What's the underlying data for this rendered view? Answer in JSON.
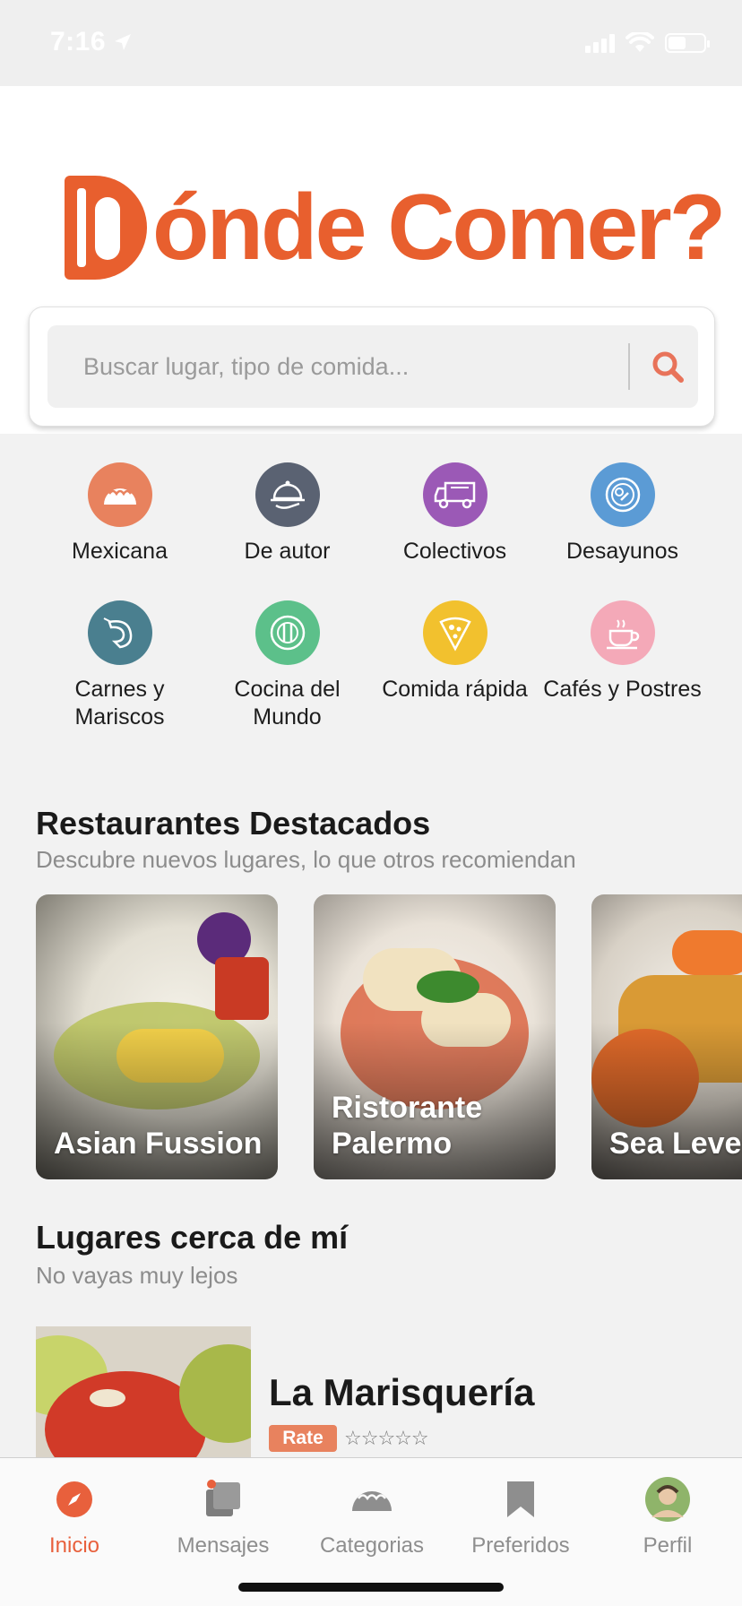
{
  "status_bar": {
    "time": "7:16"
  },
  "banner": {
    "logo_text": "ónde Comer?",
    "logo_full": "Dónde Comer?",
    "prev_label": "‹",
    "next_label": "›",
    "slides": 3,
    "active_slide": 0
  },
  "search": {
    "placeholder": "Buscar lugar, tipo de comida..."
  },
  "categories": [
    {
      "label": "Mexicana",
      "color": "#e8825e",
      "icon": "taco-icon"
    },
    {
      "label": "De autor",
      "color": "#5a6272",
      "icon": "cloche-icon"
    },
    {
      "label": "Colectivos",
      "color": "#9b59b6",
      "icon": "food-truck-icon"
    },
    {
      "label": "Desayunos",
      "color": "#5b9bd5",
      "icon": "breakfast-plate-icon"
    },
    {
      "label": "Carnes y Mariscos",
      "color": "#4a7f8f",
      "icon": "shrimp-icon"
    },
    {
      "label": "Cocina del Mundo",
      "color": "#5cc08a",
      "icon": "cutlery-plate-icon"
    },
    {
      "label": "Comida rápida",
      "color": "#f2c12e",
      "icon": "pizza-slice-icon"
    },
    {
      "label": "Cafés y Postres",
      "color": "#f4a9b8",
      "icon": "coffee-cup-icon"
    }
  ],
  "featured": {
    "title": "Restaurantes Destacados",
    "subtitle": "Descubre nuevos lugares, lo que otros recomiendan",
    "cards": [
      {
        "name": "Asian Fussion"
      },
      {
        "name": "Ristorante Palermo"
      },
      {
        "name": "Sea Level"
      }
    ]
  },
  "nearby": {
    "title": "Lugares cerca de mí",
    "subtitle": "No vayas muy lejos",
    "items": [
      {
        "name": "La Marisquería",
        "rate_label": "Rate",
        "stars": "☆☆☆☆☆"
      }
    ]
  },
  "tabbar": {
    "items": [
      {
        "label": "Inicio",
        "icon": "compass-icon",
        "active": true
      },
      {
        "label": "Mensajes",
        "icon": "messages-icon",
        "active": false
      },
      {
        "label": "Categorias",
        "icon": "taco-icon",
        "active": false
      },
      {
        "label": "Preferidos",
        "icon": "bookmark-icon",
        "active": false
      },
      {
        "label": "Perfil",
        "icon": "avatar",
        "active": false
      }
    ]
  },
  "colors": {
    "brand": "#e85f2e",
    "accent_blue": "#2c6fdc",
    "active_tab": "#e8603c"
  }
}
